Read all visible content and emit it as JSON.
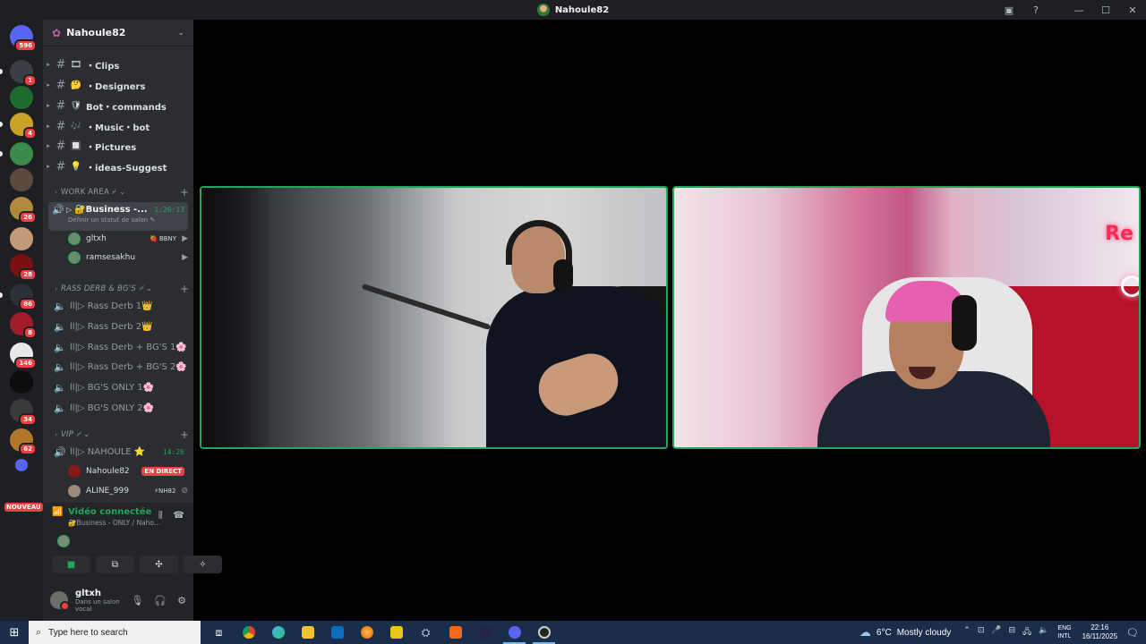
{
  "window": {
    "title": "Nahoule82",
    "controls": [
      "inbox-icon",
      "help-icon",
      "minimize",
      "maximize",
      "close"
    ]
  },
  "rail": {
    "servers": [
      {
        "badge": "596",
        "color": "#5865f2"
      },
      {
        "badge": "1",
        "color": "#3a3d44"
      },
      {
        "badge": "",
        "color": "#1d6b2d"
      },
      {
        "badge": "4",
        "color": "#c9a227"
      },
      {
        "badge": "",
        "color": "#3b8a4a"
      },
      {
        "badge": "",
        "color": "#5a4a40"
      },
      {
        "badge": "26",
        "color": "#b08a3a"
      },
      {
        "badge": "",
        "color": "#c29a7a"
      },
      {
        "badge": "28",
        "color": "#7a1010"
      },
      {
        "badge": "86",
        "color": "#2e3038"
      },
      {
        "badge": "8",
        "color": "#a01c2a"
      },
      {
        "badge": "146",
        "color": "#e8e8e8"
      },
      {
        "badge": "",
        "color": "#0d0d0d"
      },
      {
        "badge": "34",
        "color": "#3a3a3a"
      },
      {
        "badge": "62",
        "color": "#b0772a"
      },
      {
        "badge": "",
        "color": "#5865f2"
      }
    ],
    "new_label": "NOUVEAU"
  },
  "server": {
    "name": "Nahoule82"
  },
  "channels": [
    {
      "emoji": "🎞",
      "name": "・Clips"
    },
    {
      "emoji": "🤔",
      "name": "・Designers"
    },
    {
      "emoji": "🛡",
      "name": "Bot・commands"
    },
    {
      "emoji": "🎶",
      "name": "・Music・bot"
    },
    {
      "emoji": "🔲",
      "name": "・Pictures"
    },
    {
      "emoji": "💡",
      "name": "・ideas-Suggest"
    }
  ],
  "categories": {
    "work": "WORK AREA ⌿ ⌄",
    "rass": "RASS DERB & BG'S ⌿ ⌄",
    "vip": "VIP ⌿ ⌄"
  },
  "active_voice": {
    "name": "🔐Business -...",
    "time": "1:26:13",
    "status": "Définir un statut de salon ✎",
    "users": [
      {
        "name": "gltxh",
        "tag": "🍓 BBNY"
      },
      {
        "name": "ramsesakhu",
        "tag": ""
      }
    ]
  },
  "voice_channels": [
    "ll|▷ Rass Derb 1👑",
    "ll|▷ Rass Derb 2👑",
    "ll|▷ Rass Derb + BG'S 1🌸",
    "ll|▷ Rass Derb + BG'S 2🌸",
    "ll|▷ BG'S ONLY 1🌸",
    "ll|▷ BG'S ONLY 2🌸"
  ],
  "vip_channel": {
    "name": "ll|▷ NAHOULE ⭐",
    "time": "14:26",
    "users": [
      {
        "name": "Nahoule82",
        "live": "EN DIRECT"
      },
      {
        "name": "ALINE_999",
        "tag": "⚡NH82"
      }
    ]
  },
  "voice_panel": {
    "connected": "Vidéo connectée",
    "channel": "🔐Business - ONLY / Naho..."
  },
  "user": {
    "name": "gltxh",
    "status": "Dans un salon vocal"
  },
  "video": {
    "neon_text": "Re"
  },
  "taskbar": {
    "search_placeholder": "Type here to search",
    "weather_temp": "6°C",
    "weather_desc": "Mostly cloudy",
    "lang_1": "ENG",
    "lang_2": "INTL",
    "time": "22:16",
    "date": "16/11/2025"
  }
}
